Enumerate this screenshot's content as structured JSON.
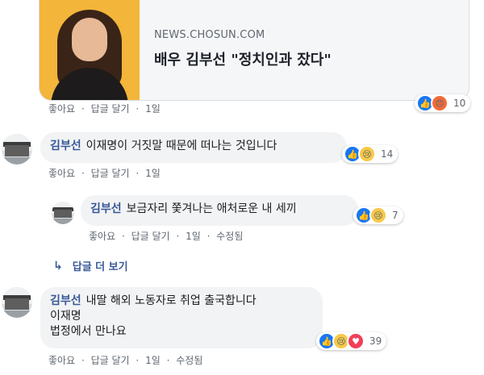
{
  "preview": {
    "domain": "NEWS.CHOSUN.COM",
    "title": "배우 김부선 \"정치인과 잤다\""
  },
  "post_actions": {
    "like": "좋아요",
    "reply": "답글 달기",
    "time": "1일",
    "reaction_count": "10",
    "reactions": [
      "like-icon",
      "angry-icon"
    ]
  },
  "comments": [
    {
      "author": "김부선",
      "text": "이재명이 거짓말 때문에 떠나는 것입니다",
      "like": "좋아요",
      "reply": "답글 달기",
      "time": "1일",
      "reaction_count": "14",
      "reactions": [
        "like-icon",
        "sad-icon"
      ]
    },
    {
      "author": "김부선",
      "text": "보금자리 쫓겨나는 애처로운 내 세끼",
      "like": "좋아요",
      "reply": "답글 달기",
      "time": "1일",
      "edited": "수정됨",
      "reaction_count": "7",
      "reactions": [
        "like-icon",
        "sad-icon"
      ]
    },
    {
      "author": "김부선",
      "line1": "내딸 해외 노동자로 취업 출국합니다",
      "line2": "이재명",
      "line3": "법정에서 만나요",
      "like": "좋아요",
      "reply": "답글 달기",
      "time": "1일",
      "edited": "수정됨",
      "reaction_count": "39",
      "reactions": [
        "like-icon",
        "sad-icon",
        "love-icon"
      ]
    }
  ],
  "more_replies": "답글 더 보기",
  "sep": "·",
  "colors": {
    "link": "#385898",
    "bubble": "#f2f3f5",
    "like": "#1877f2",
    "sad": "#f7c948",
    "angry": "#f26b37",
    "love": "#f33e58"
  }
}
